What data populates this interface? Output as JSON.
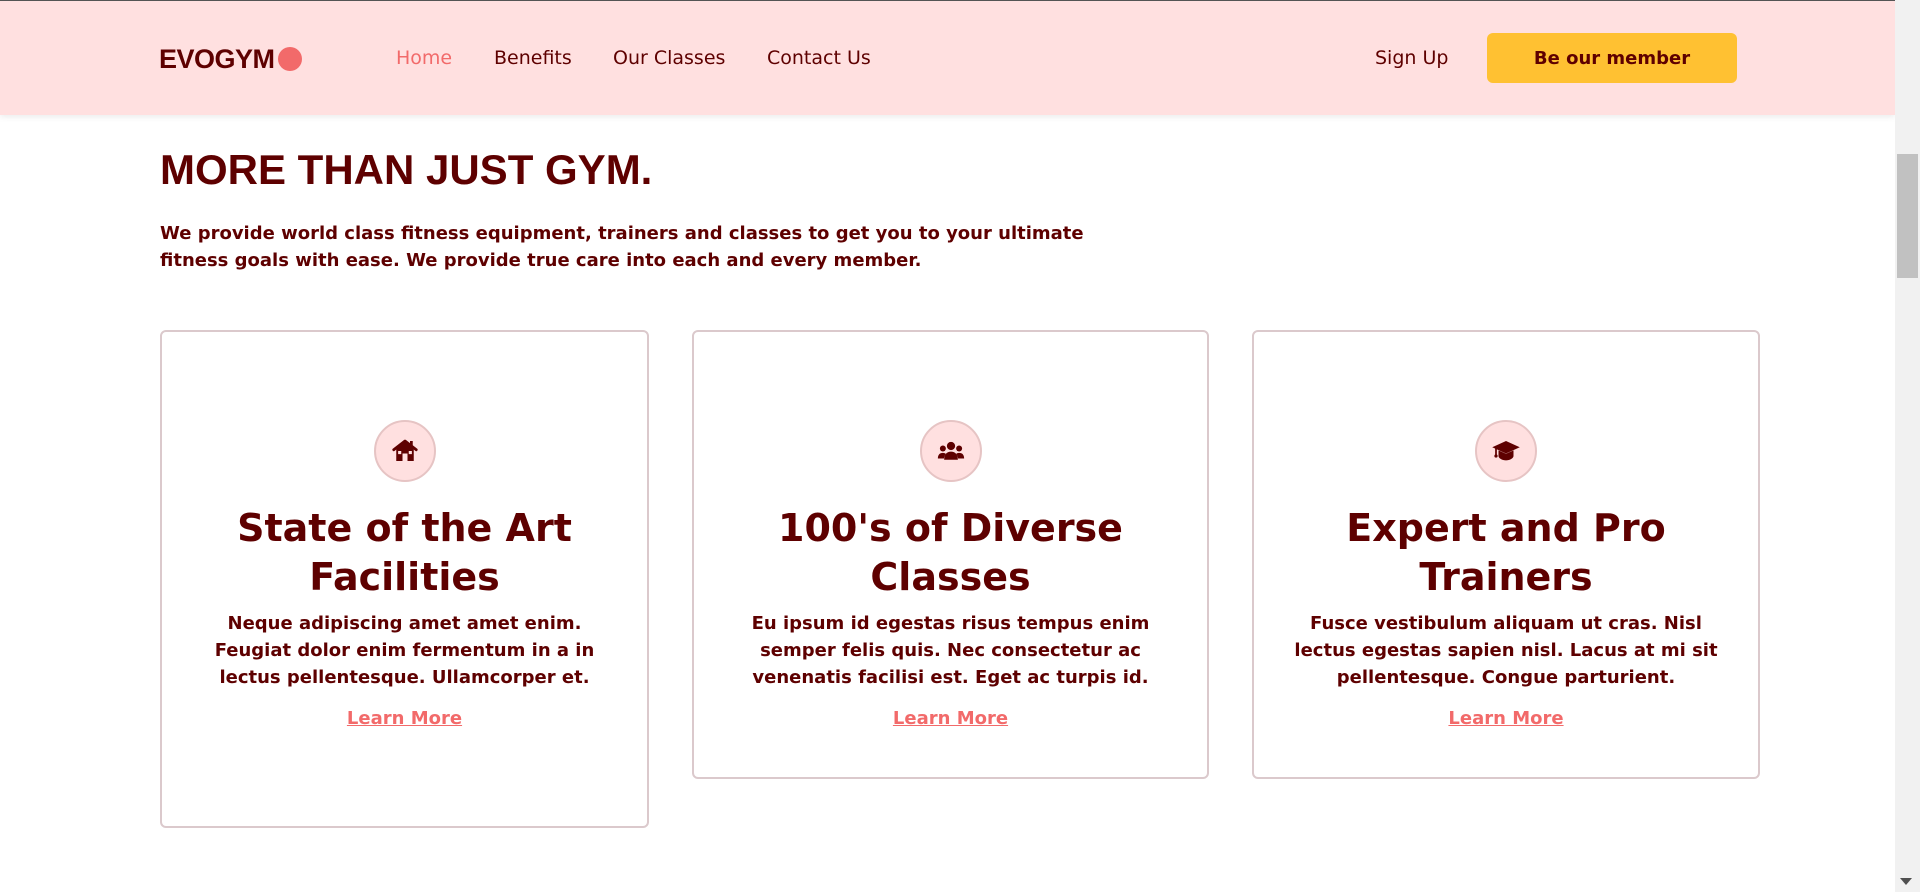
{
  "navbar": {
    "logo_text": "EVOGYM",
    "links": [
      {
        "label": "Home",
        "active": true
      },
      {
        "label": "Benefits",
        "active": false
      },
      {
        "label": "Our Classes",
        "active": false
      },
      {
        "label": "Contact Us",
        "active": false
      }
    ],
    "sign_up": "Sign Up",
    "cta": "Be our member"
  },
  "section": {
    "title": "MORE THAN JUST GYM.",
    "intro": "We provide world class fitness equipment, trainers and classes to get you to your ultimate fitness goals with ease. We provide true care into each and every member."
  },
  "cards": [
    {
      "icon": "home-icon",
      "title": "State of the Art Facilities",
      "text": "Neque adipiscing amet amet enim. Feugiat dolor enim fermentum in a in lectus pellentesque. Ullamcorper et.",
      "link": "Learn More"
    },
    {
      "icon": "user-group-icon",
      "title": "100's of Diverse Classes",
      "text": "Eu ipsum id egestas risus tempus enim semper felis quis. Nec consectetur ac venenatis facilisi est. Eget ac turpis id.",
      "link": "Learn More"
    },
    {
      "icon": "graduation-cap-icon",
      "title": "Expert and Pro Trainers",
      "text": "Fusce vestibulum aliquam ut cras. Nisl lectus egestas sapien nisl. Lacus at mi sit pellentesque. Congue parturient.",
      "link": "Learn More"
    }
  ],
  "colors": {
    "primary_text": "#5e0000",
    "accent": "#f26a6a",
    "nav_bg": "#ffe0e0",
    "cta_bg": "#ffc132"
  }
}
